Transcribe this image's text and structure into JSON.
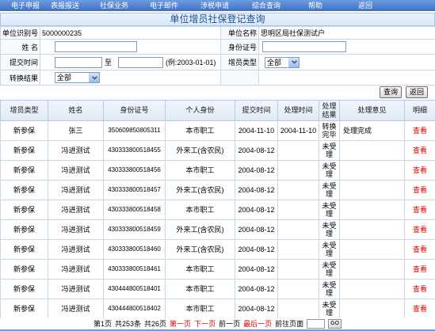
{
  "nav": {
    "items": [
      "电子申报",
      "表报报送",
      "社保业务",
      "电子邮件",
      "涉税申请",
      "综合查询",
      "帮助",
      "返回"
    ]
  },
  "title": "单位增员社保登记查询",
  "form": {
    "unit_id_label": "单位识别号",
    "unit_id_value": "5000000235",
    "unit_name_label": "单位名称",
    "unit_name_value": "思明区局社保测试户",
    "name_label": "姓 名",
    "name_value": "",
    "id_label": "身份证号",
    "id_value": "",
    "submit_time_label": "提交时间",
    "date_from": "",
    "to_label": "至",
    "date_to": "",
    "date_hint": "(例:2003-01-01)",
    "type_label": "增员类型",
    "type_selected": "全部",
    "result_label": "转换结果",
    "result_selected": "全部"
  },
  "actions": {
    "query": "查询",
    "back": "返回"
  },
  "table": {
    "headers": [
      "增员类型",
      "姓名",
      "身份证号",
      "个人身份",
      "提交时间",
      "处理时间",
      "处理结果",
      "处理意见",
      "明细"
    ],
    "rows": [
      {
        "type": "新参保",
        "name": "张三",
        "id_number": "350609850805311",
        "identity": "本市职工",
        "submit_time": "2004-11-10",
        "process_time": "2004-11-10",
        "result": "转换完毕",
        "opinion": "处理完成",
        "detail": "查看"
      },
      {
        "type": "新参保",
        "name": "冯进测试",
        "id_number": "430333800518455",
        "identity": "外来工(含农民)",
        "submit_time": "2004-08-12",
        "process_time": "",
        "result": "未受理",
        "opinion": "",
        "detail": "查看"
      },
      {
        "type": "新参保",
        "name": "冯进测试",
        "id_number": "430333800518456",
        "identity": "本市职工",
        "submit_time": "2004-08-12",
        "process_time": "",
        "result": "未受理",
        "opinion": "",
        "detail": "查看"
      },
      {
        "type": "新参保",
        "name": "冯进测试",
        "id_number": "430333800518457",
        "identity": "外来工(含农民)",
        "submit_time": "2004-08-12",
        "process_time": "",
        "result": "未受理",
        "opinion": "",
        "detail": "查看"
      },
      {
        "type": "新参保",
        "name": "冯进测试",
        "id_number": "430333800518458",
        "identity": "本市职工",
        "submit_time": "2004-08-12",
        "process_time": "",
        "result": "未受理",
        "opinion": "",
        "detail": "查看"
      },
      {
        "type": "新参保",
        "name": "冯进测试",
        "id_number": "430333800518459",
        "identity": "外来工(含农民)",
        "submit_time": "2004-08-12",
        "process_time": "",
        "result": "未受理",
        "opinion": "",
        "detail": "查看"
      },
      {
        "type": "新参保",
        "name": "冯进测试",
        "id_number": "430333800518460",
        "identity": "外来工(含农民)",
        "submit_time": "2004-08-12",
        "process_time": "",
        "result": "未受理",
        "opinion": "",
        "detail": "查看"
      },
      {
        "type": "新参保",
        "name": "冯进测试",
        "id_number": "430333800518461",
        "identity": "本市职工",
        "submit_time": "2004-08-12",
        "process_time": "",
        "result": "未受理",
        "opinion": "",
        "detail": "查看"
      },
      {
        "type": "新参保",
        "name": "冯进测试",
        "id_number": "430444800518401",
        "identity": "本市职工",
        "submit_time": "2004-08-12",
        "process_time": "",
        "result": "未受理",
        "opinion": "",
        "detail": "查看"
      },
      {
        "type": "新参保",
        "name": "冯进测试",
        "id_number": "430444800518402",
        "identity": "本市职工",
        "submit_time": "2004-08-12",
        "process_time": "",
        "result": "未受理",
        "opinion": "",
        "detail": "查看"
      }
    ]
  },
  "pagination": {
    "current_page": "第1页",
    "total_records": "共253条",
    "total_pages": "共26页",
    "first": "第一页",
    "next": "下一页",
    "prev": "前一页",
    "last": "最后一页",
    "goto_label": "前往页面",
    "goto_value": "",
    "go": "GO"
  },
  "icons": {
    "select_arrow": "chevron-down-icon"
  },
  "colors": {
    "nav_bar": "#3f70c2",
    "nav_text": "#ffffff",
    "title_bg": "#d9e7f7",
    "title_text": "#1d4f9c",
    "header_bg": "#dfe8f4",
    "grid_line": "#c9d7ea",
    "link_red": "#e00000"
  }
}
